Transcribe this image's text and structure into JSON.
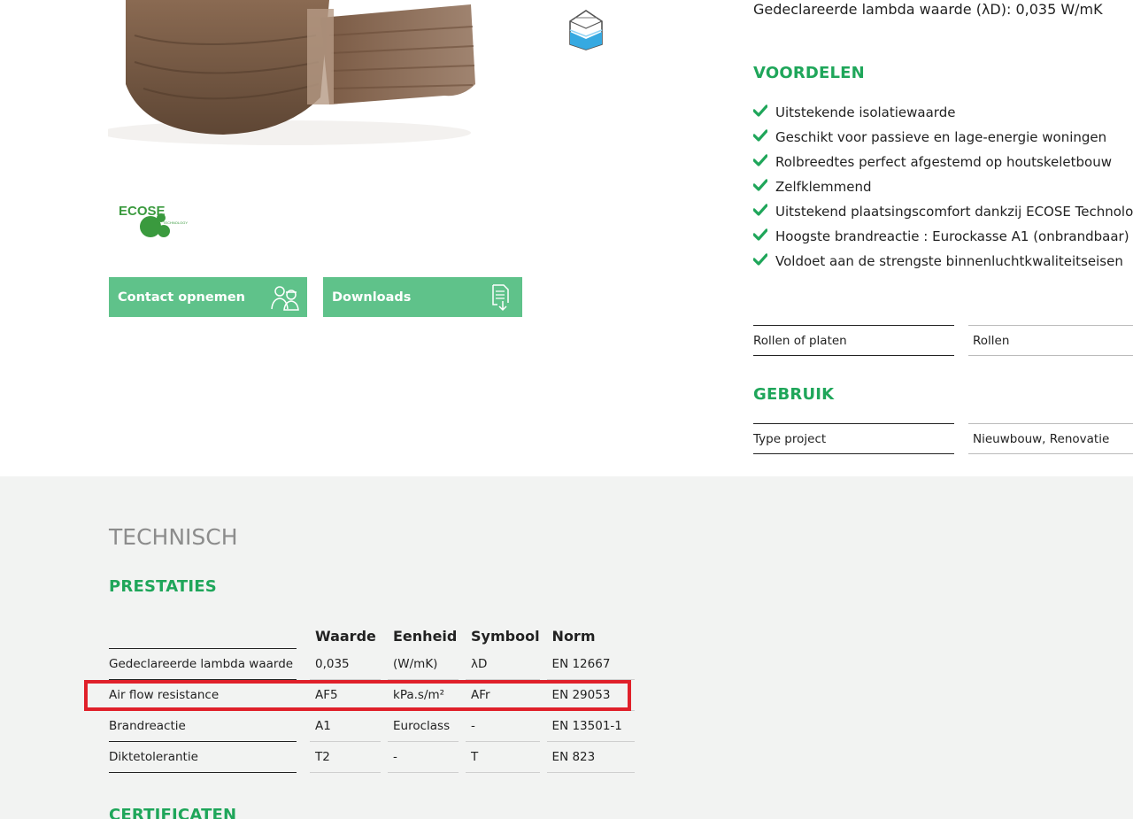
{
  "product": {
    "image_alt": "product-roll",
    "roll_icon": "roll-insulation-icon",
    "logo_text": "ECOSE",
    "logo_subtext": "TECHNOLOGY"
  },
  "buttons": {
    "contact": "Contact opnemen",
    "downloads": "Downloads"
  },
  "lambda_line": "Gedeclareerde lambda waarde (λD): 0,035 W/mK",
  "voordelen": {
    "heading": "VOORDELEN",
    "items": [
      "Uitstekende isolatiewaarde",
      "Geschikt voor passieve en lage-energie woningen",
      "Rolbreedtes perfect afgestemd op houtskeletbouw",
      "Zelfklemmend",
      "Uitstekend plaatsingscomfort dankzij ECOSE Technology",
      "Hoogste brandreactie : Eurockasse A1 (onbrandbaar)",
      "Voldoet aan de strengste binnenluchtkwaliteitseisen"
    ]
  },
  "specs": {
    "form_label": "Rollen of platen",
    "form_value": "Rollen",
    "gebruik_heading": "GEBRUIK",
    "project_label": "Type project",
    "project_value": "Nieuwbouw, Renovatie"
  },
  "technisch": {
    "heading": "TECHNISCH",
    "prestaties": "PRESTATIES",
    "columns": [
      "Waarde",
      "Eenheid",
      "Symbool",
      "Norm"
    ],
    "rows": [
      {
        "name": "Gedeclareerde lambda waarde",
        "waarde": "0,035",
        "eenheid": "(W/mK)",
        "symbool": "λD",
        "norm": "EN 12667"
      },
      {
        "name": "Air flow resistance",
        "waarde": "AF5",
        "eenheid": "kPa.s/m²",
        "symbool": "AFr",
        "norm": "EN 29053"
      },
      {
        "name": "Brandreactie",
        "waarde": "A1",
        "eenheid": "Euroclass",
        "symbool": "-",
        "norm": "EN 13501-1"
      },
      {
        "name": "Diktetolerantie",
        "waarde": "T2",
        "eenheid": "-",
        "symbool": "T",
        "norm": "EN 823"
      }
    ],
    "certificaten": "CERTIFICATEN"
  },
  "colors": {
    "green_heading": "#1fa65a",
    "button": "#5fc28a",
    "highlight": "#e0202a",
    "section_bg": "#f2f3f2"
  }
}
